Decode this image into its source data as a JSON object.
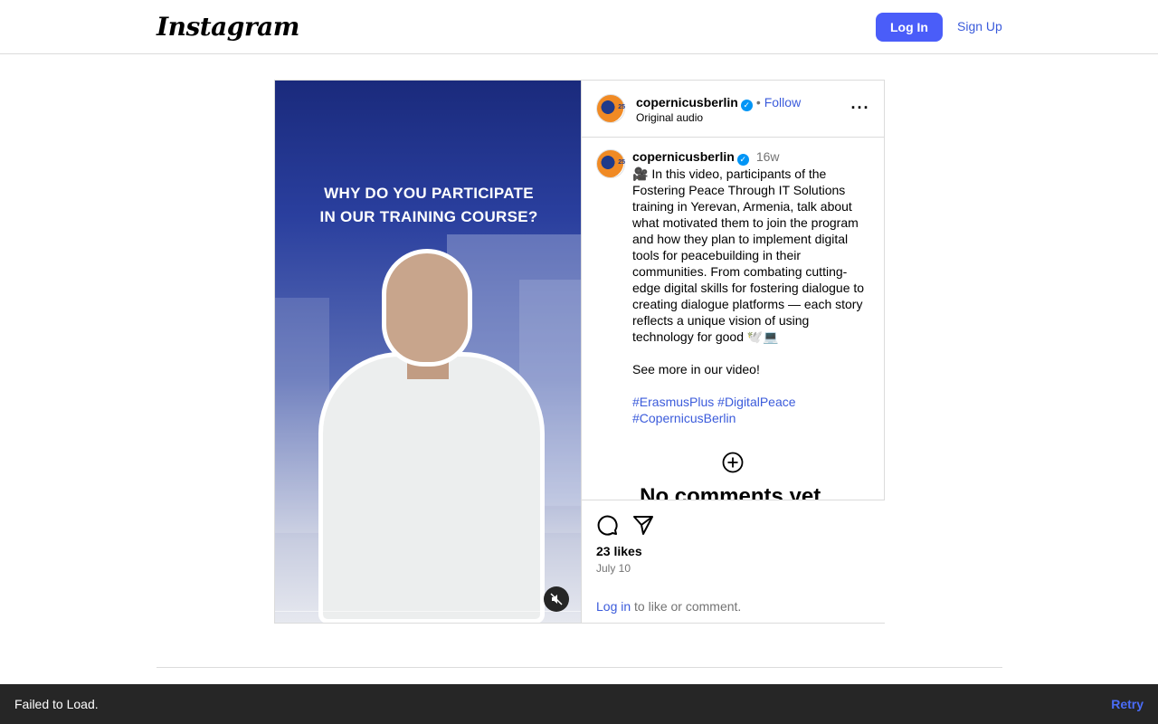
{
  "header": {
    "logo_text": "Instagram",
    "login_label": "Log In",
    "signup_label": "Sign Up"
  },
  "media": {
    "caption_line1": "WHY DO YOU PARTICIPATE",
    "caption_line2": "IN OUR TRAINING COURSE?",
    "mute_icon": "muted-speaker-icon"
  },
  "post": {
    "username": "copernicusberlin",
    "avatar_badge": "25",
    "separator": "•",
    "follow_label": "Follow",
    "audio": "Original audio",
    "more_icon": "more-options-icon",
    "time": "16w",
    "caption": "🎥 In this video, participants of the Fostering Peace Through IT Solutions training in Yerevan, Armenia, talk about what motivated them to join the program and how they plan to implement digital tools for peacebuilding in their communities. From combating cutting-edge digital skills for fostering dialogue to creating dialogue platforms — each story reflects a unique vision of using technology for good 🕊️💻\n\nSee more in our video!\n\n",
    "hashtags": [
      "#ErasmusPlus",
      "#DigitalPeace",
      "#CopernicusBerlin"
    ],
    "no_comments": "No comments yet.",
    "likes": "23 likes",
    "date": "July 10",
    "login_link": "Log in",
    "login_suffix": " to like or comment."
  },
  "toast": {
    "message": "Failed to Load.",
    "retry_label": "Retry"
  },
  "colors": {
    "accent": "#4a5df9",
    "link": "#3b5bdb",
    "verified": "#0095f6",
    "toast_bg": "#262626"
  }
}
